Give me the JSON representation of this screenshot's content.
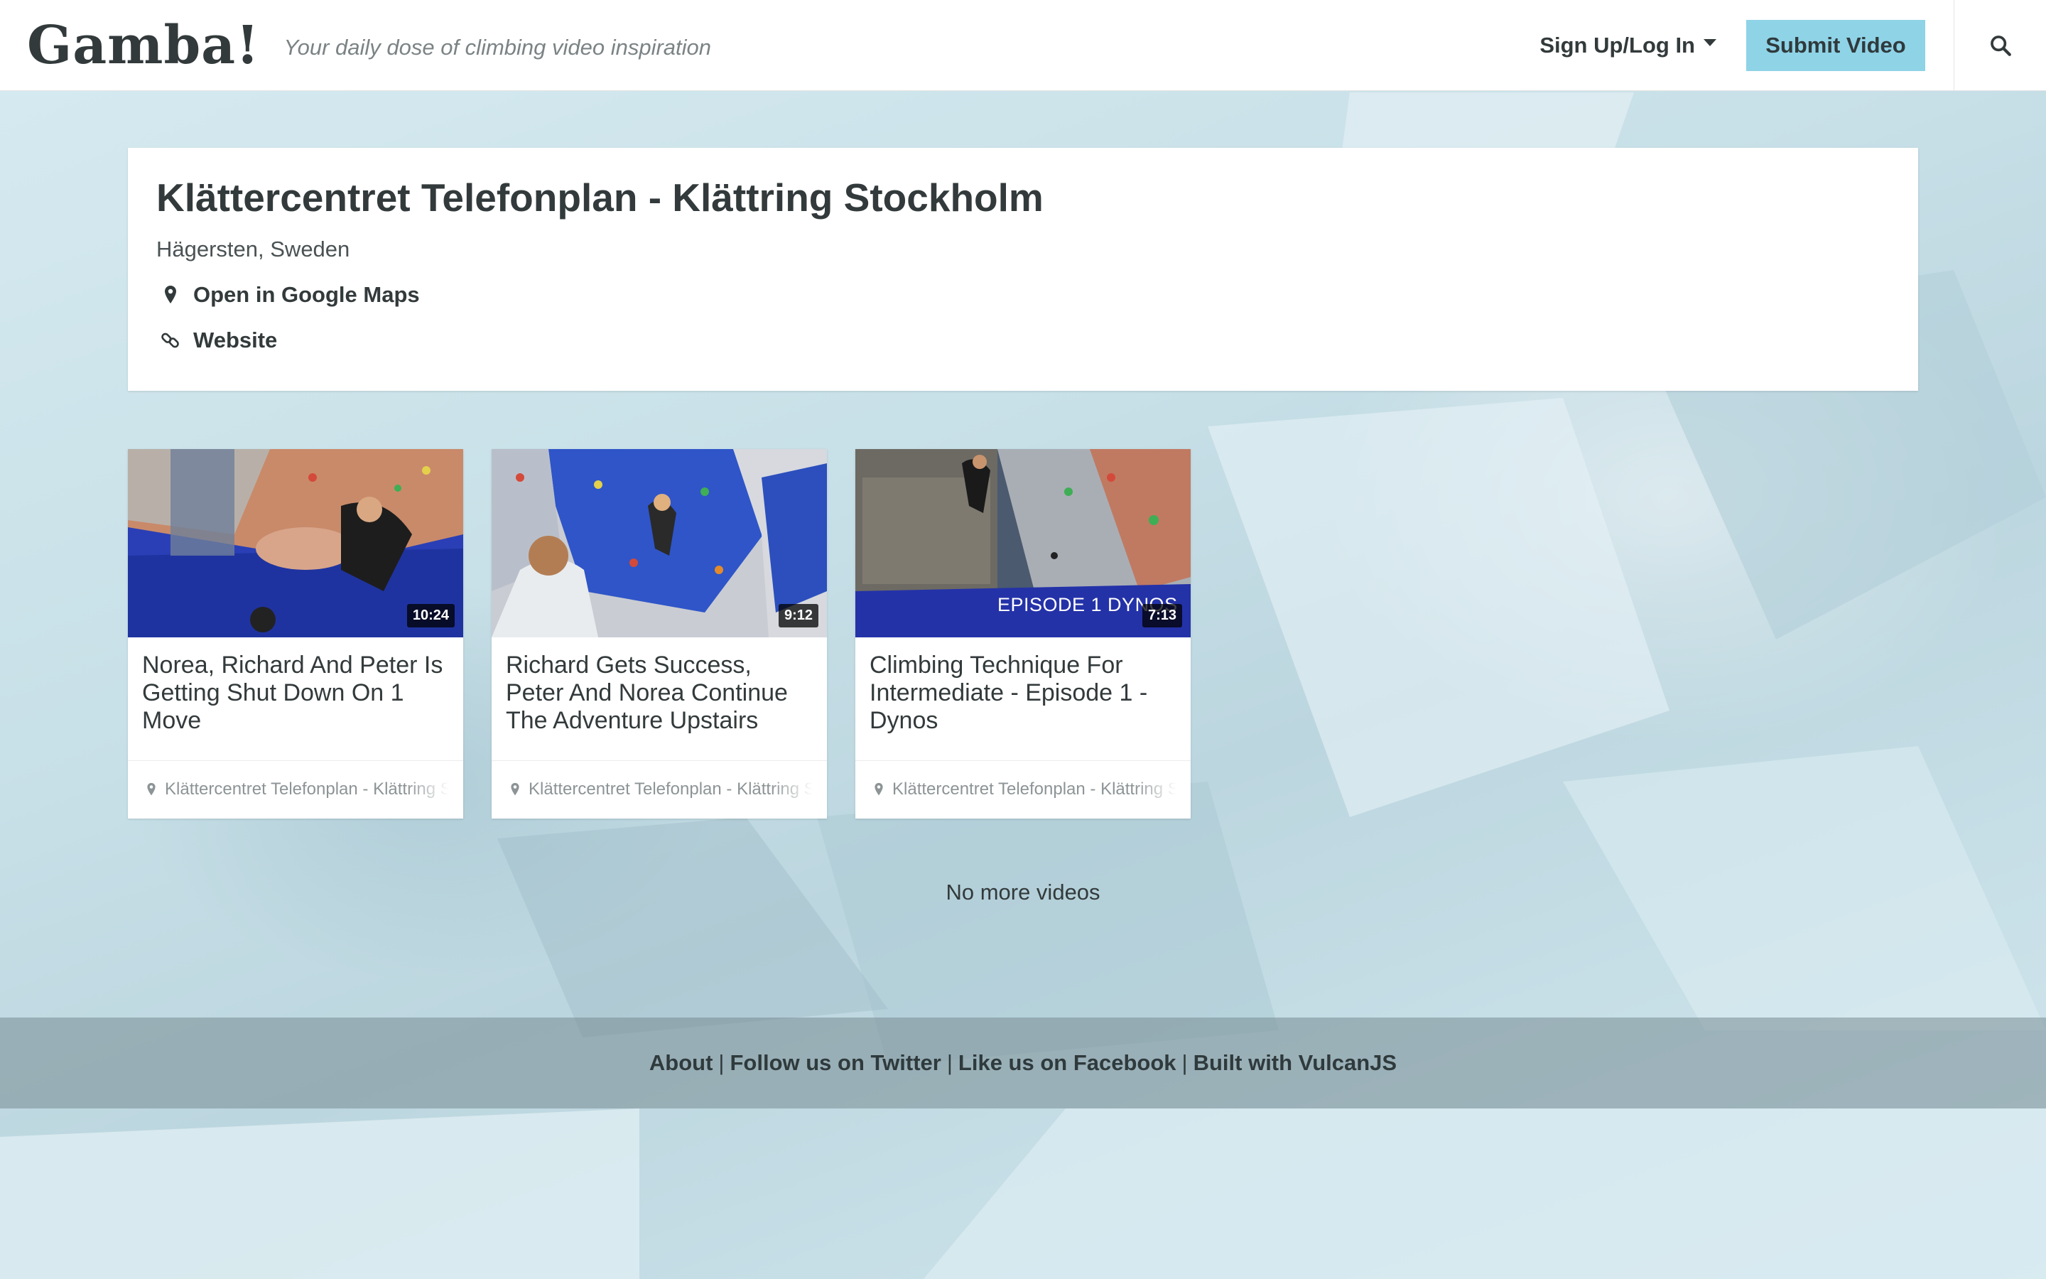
{
  "header": {
    "logo": "Gamba!",
    "tagline": "Your daily dose of climbing video inspiration",
    "auth_label": "Sign Up/Log In",
    "submit_label": "Submit Video",
    "search_icon": "search-icon"
  },
  "place": {
    "title": "Klättercentret Telefonplan - Klättring Stockholm",
    "location": "Hägersten, Sweden",
    "maps_label": "Open in Google Maps",
    "website_label": "Website"
  },
  "videos": [
    {
      "title": "Norea, Richard And Peter Is Getting Shut Down On 1 Move",
      "duration": "10:24",
      "location": "Klättercentret Telefonplan - Klättring Stockholm",
      "overlay": ""
    },
    {
      "title": "Richard Gets Success, Peter And Norea Continue The Adventure Upstairs",
      "duration": "9:12",
      "location": "Klättercentret Telefonplan - Klättring Stockholm",
      "overlay": ""
    },
    {
      "title": "Climbing Technique For Intermediate - Episode 1 - Dynos",
      "duration": "7:13",
      "location": "Klättercentret Telefonplan - Klättring Stockholm",
      "overlay": "EPISODE 1 DYNOS"
    }
  ],
  "no_more": "No more videos",
  "footer": {
    "about": "About",
    "twitter": "Follow us on Twitter",
    "facebook": "Like us on Facebook",
    "vulcan": "Built with VulcanJS",
    "separator": "|"
  },
  "colors": {
    "accent": "#8fd3e7",
    "text": "#333a3b"
  }
}
